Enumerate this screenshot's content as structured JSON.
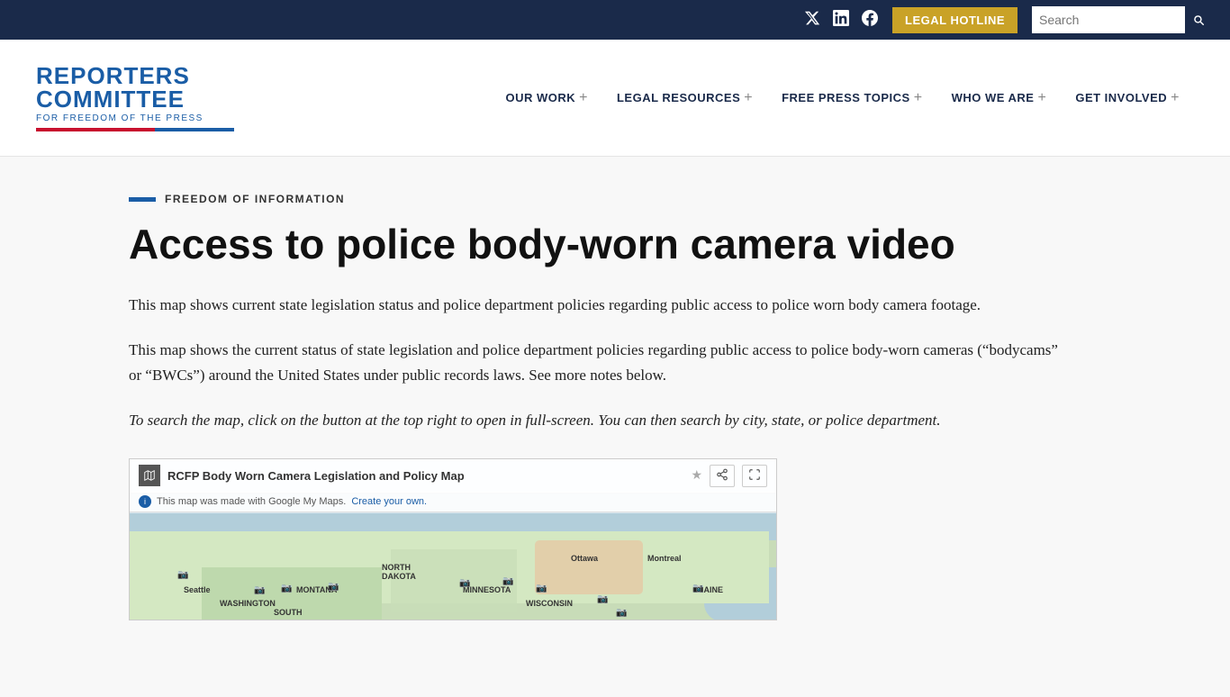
{
  "topbar": {
    "twitter_icon": "𝕏",
    "linkedin_icon": "in",
    "facebook_icon": "f",
    "hotline_label": "LEGAL HOTLINE",
    "search_placeholder": "Search"
  },
  "header": {
    "logo": {
      "line1": "REPORTERS",
      "line2": "COMMITTEE",
      "tagline": "FOR FREEDOM OF THE PRESS"
    },
    "nav": [
      {
        "label": "OUR WORK",
        "id": "our-work"
      },
      {
        "label": "LEGAL RESOURCES",
        "id": "legal-resources"
      },
      {
        "label": "FREE PRESS TOPICS",
        "id": "free-press-topics"
      },
      {
        "label": "WHO WE ARE",
        "id": "who-we-are"
      },
      {
        "label": "GET INVOLVED",
        "id": "get-involved"
      }
    ]
  },
  "page": {
    "category": "FREEDOM OF INFORMATION",
    "title": "Access to police body-worn camera video",
    "intro": "This map shows current state legislation status and police department policies regarding public access to police worn body camera footage.",
    "body": "This map shows the current status of state legislation and police department policies regarding public access to police body-worn cameras (“bodycams” or “BWCs”) around the United States under public records laws. See more notes below.",
    "instruction": "To search the map, click on the button at the top right to open in full-screen. You can then search by city, state, or police department."
  },
  "map": {
    "icon_text": "M",
    "title": "RCFP Body Worn Camera Legislation and Policy Map",
    "info_text": "This map was made with Google My Maps.",
    "create_link_text": "Create your own.",
    "share_icon": "⬆",
    "fullscreen_icon": "⛶"
  }
}
